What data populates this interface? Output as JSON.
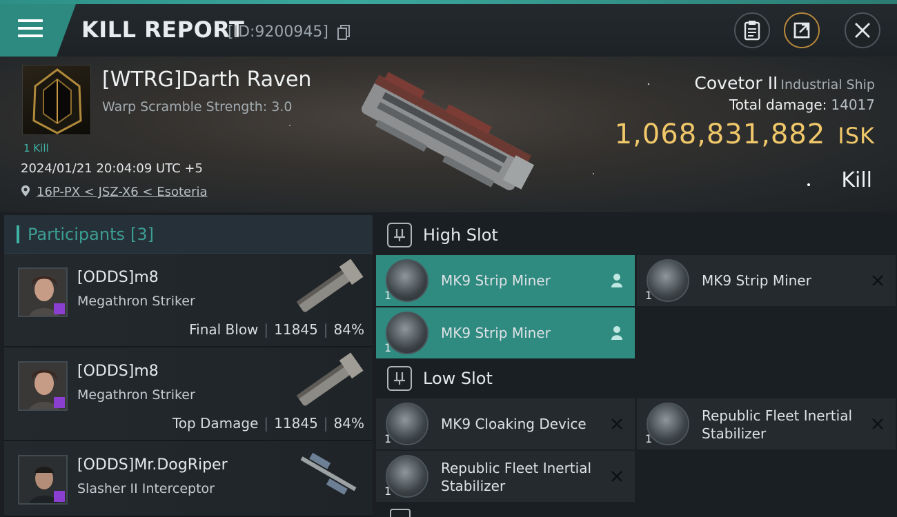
{
  "header": {
    "title": "KILL REPORT",
    "report_id": "[ID:9200945]"
  },
  "victim": {
    "pilot_name": "[WTRG]Darth Raven",
    "warp_scramble": "Warp Scramble Strength: 3.0",
    "kills": "1 Kill",
    "datetime": "2024/01/21 20:04:09 UTC +5",
    "location": "16P-PX < JSZ-X6 < Esoteria",
    "ship_name": "Covetor II",
    "ship_class": "Industrial Ship",
    "total_damage_label": "Total damage:",
    "total_damage": "14017",
    "isk_value": "1,068,831,882",
    "isk_unit": "ISK",
    "result": "Kill"
  },
  "participants": {
    "title": "Participants",
    "count": "[3]",
    "rows": [
      {
        "name": "[ODDS]m8",
        "ship": "Megathron Striker",
        "role": "Final Blow",
        "damage": "11845",
        "percent": "84%"
      },
      {
        "name": "[ODDS]m8",
        "ship": "Megathron Striker",
        "role": "Top Damage",
        "damage": "11845",
        "percent": "84%"
      },
      {
        "name": "[ODDS]Mr.DogRiper",
        "ship": "Slasher II Interceptor"
      }
    ]
  },
  "slots": {
    "high_title": "High Slot",
    "low_title": "Low Slot",
    "high_items": [
      {
        "name": "MK9 Strip Miner",
        "qty": "1",
        "status": "pilot-icon"
      },
      {
        "name": "MK9 Strip Miner",
        "qty": "1",
        "status": "destroyed-x-icon"
      },
      {
        "name": "MK9 Strip Miner",
        "qty": "1",
        "status": "pilot-icon"
      }
    ],
    "low_items": [
      {
        "name": "MK9 Cloaking Device",
        "qty": "1",
        "status": "destroyed-x-icon"
      },
      {
        "name1": "Republic Fleet Inertial",
        "name2": "Stabilizer",
        "qty": "1",
        "status": "destroyed-x-icon"
      },
      {
        "name1": "Republic Fleet Inertial",
        "name2": "Stabilizer",
        "qty": "1",
        "status": "destroyed-x-icon"
      }
    ]
  },
  "colors": {
    "accent": "#2f8a80",
    "isk": "#f0c86a",
    "purple_badge": "#8b3fd1"
  }
}
